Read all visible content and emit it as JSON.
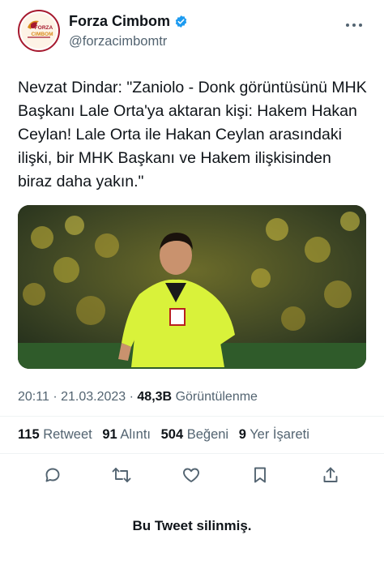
{
  "account": {
    "name": "Forza Cimbom",
    "handle": "@forzacimbomtr",
    "avatar_text_top": "FORZA",
    "avatar_text_bottom": "CIMBOM",
    "verified_icon": "verified-badge-icon",
    "more_icon": "more-options-icon"
  },
  "tweet": {
    "text": "Nevzat Dindar: \"Zaniolo - Donk görüntüsünü MHK Başkanı Lale Orta'ya aktaran kişi: Hakem Hakan Ceylan! Lale Orta ile Hakan Ceylan arasındaki ilişki, bir MHK Başkanı ve Hakem ilişkisinden biraz daha yakın.\"",
    "media_icon": "referee-photo-icon"
  },
  "meta": {
    "time": "20:11",
    "separator": "·",
    "date": "21.03.2023",
    "views_count": "48,3B",
    "views_label": "Görüntülenme"
  },
  "stats": {
    "retweets_count": "115",
    "retweets_label": "Retweet",
    "quotes_count": "91",
    "quotes_label": "Alıntı",
    "likes_count": "504",
    "likes_label": "Beğeni",
    "bookmarks_count": "9",
    "bookmarks_label": "Yer İşareti"
  },
  "actions": [
    "reply-icon",
    "retweet-icon",
    "like-icon",
    "bookmark-icon",
    "share-icon"
  ],
  "footer": {
    "deleted_notice": "Bu Tweet silinmiş."
  },
  "colors": {
    "text_primary": "#0f1419",
    "text_secondary": "#536471",
    "verified_blue": "#1d9bf0",
    "brand_red": "#a6192e",
    "divider": "#eff3f4"
  }
}
